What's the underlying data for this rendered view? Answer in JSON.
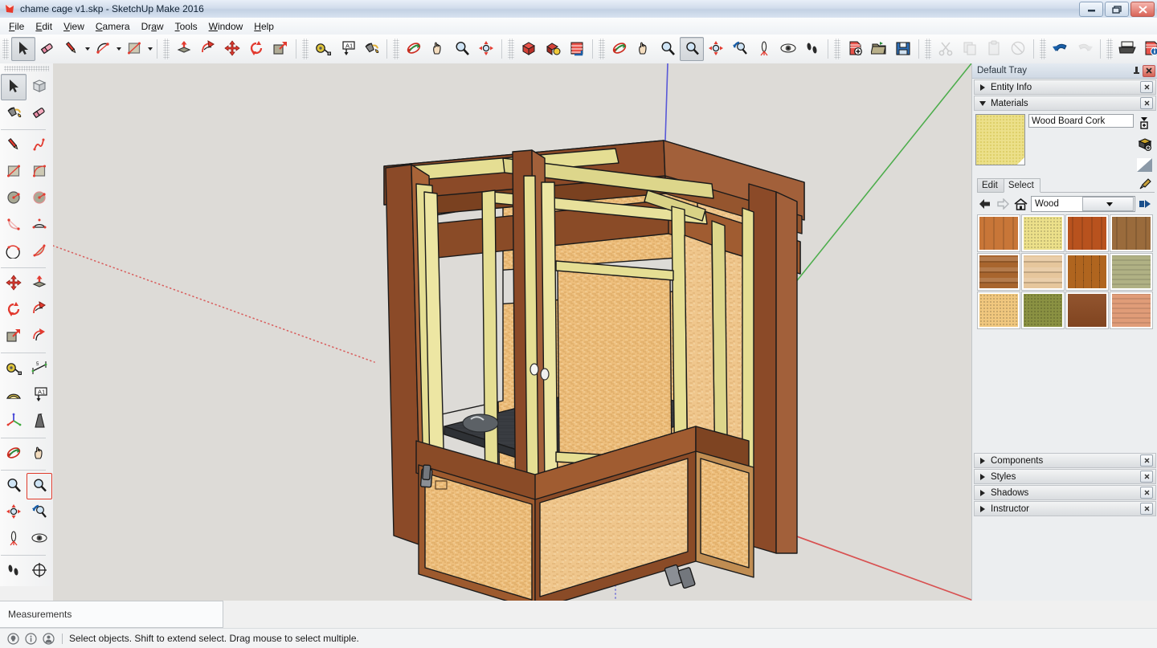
{
  "window": {
    "title": "chame cage v1.skp - SketchUp Make 2016",
    "app_icon": "sketchup-logo-icon",
    "minimize_label": "Minimize",
    "maximize_label": "Restore",
    "close_label": "Close"
  },
  "menu": {
    "items": [
      {
        "label": "File",
        "accel": "F"
      },
      {
        "label": "Edit",
        "accel": "E"
      },
      {
        "label": "View",
        "accel": "V"
      },
      {
        "label": "Camera",
        "accel": "C"
      },
      {
        "label": "Draw",
        "accel": "a"
      },
      {
        "label": "Tools",
        "accel": "T"
      },
      {
        "label": "Window",
        "accel": "W"
      },
      {
        "label": "Help",
        "accel": "H"
      }
    ]
  },
  "top_toolbar": {
    "groups": [
      {
        "name": "drawing-tools",
        "buttons": [
          {
            "name": "select-tool",
            "icon": "arrow-cursor-icon",
            "active": true
          },
          {
            "name": "eraser-tool",
            "icon": "eraser-icon",
            "active": false
          },
          {
            "name": "line-tool",
            "icon": "pencil-icon",
            "active": false,
            "dropdown": true
          },
          {
            "name": "arc-tool",
            "icon": "arc-icon",
            "active": false,
            "dropdown": true
          },
          {
            "name": "rectangle-tool",
            "icon": "rectangle-icon",
            "active": false,
            "dropdown": true
          }
        ]
      },
      {
        "name": "modify-tools",
        "buttons": [
          {
            "name": "pushpull-tool",
            "icon": "pushpull-icon",
            "active": false
          },
          {
            "name": "followme-tool",
            "icon": "followme-icon",
            "active": false
          },
          {
            "name": "move-tool",
            "icon": "move-arrows-icon",
            "active": false
          },
          {
            "name": "rotate-tool",
            "icon": "rotate-icon",
            "active": false
          },
          {
            "name": "scale-tool",
            "icon": "scale-icon",
            "active": false
          }
        ]
      },
      {
        "name": "construction-tools",
        "buttons": [
          {
            "name": "tape-measure-tool",
            "icon": "tape-measure-icon",
            "active": false
          },
          {
            "name": "text-tool",
            "icon": "text-label-icon",
            "active": false
          },
          {
            "name": "paint-bucket-tool",
            "icon": "paint-bucket-icon",
            "active": false
          }
        ]
      },
      {
        "name": "camera-tools-1",
        "buttons": [
          {
            "name": "orbit-tool",
            "icon": "orbit-icon",
            "active": false
          },
          {
            "name": "pan-tool",
            "icon": "hand-pan-icon",
            "active": false
          },
          {
            "name": "zoom-tool",
            "icon": "magnifier-icon",
            "active": false
          },
          {
            "name": "zoom-extents-tool",
            "icon": "zoom-extents-icon",
            "active": false
          }
        ]
      },
      {
        "name": "view-styles",
        "buttons": [
          {
            "name": "style-xray",
            "icon": "xray-box-icon",
            "active": false
          },
          {
            "name": "style-shaded",
            "icon": "shaded-box-icon",
            "active": false
          },
          {
            "name": "style-texture",
            "icon": "texture-box-icon",
            "active": false
          }
        ]
      },
      {
        "name": "camera-tools-2",
        "buttons": [
          {
            "name": "orbit-tool-2",
            "icon": "orbit-icon",
            "active": false
          },
          {
            "name": "pan-tool-2",
            "icon": "hand-pan-icon",
            "active": false
          },
          {
            "name": "zoom-tool-2",
            "icon": "magnifier-icon",
            "active": false
          },
          {
            "name": "zoom-window-tool",
            "icon": "zoom-window-icon",
            "active": true
          },
          {
            "name": "zoom-extents-tool-2",
            "icon": "zoom-extents-icon",
            "active": false
          },
          {
            "name": "previous-view-tool",
            "icon": "previous-view-icon",
            "active": false
          },
          {
            "name": "position-camera-tool",
            "icon": "position-camera-icon",
            "active": false
          },
          {
            "name": "look-around-tool",
            "icon": "eye-icon",
            "active": false
          },
          {
            "name": "walk-tool",
            "icon": "footprints-icon",
            "active": false
          }
        ]
      },
      {
        "name": "file-tools",
        "buttons": [
          {
            "name": "new-file-button",
            "icon": "new-document-icon",
            "active": false
          },
          {
            "name": "open-file-button",
            "icon": "open-folder-icon",
            "active": false
          },
          {
            "name": "save-file-button",
            "icon": "floppy-save-icon",
            "active": false
          }
        ]
      },
      {
        "name": "edit-tools",
        "buttons": [
          {
            "name": "cut-button",
            "icon": "scissors-icon",
            "disabled": true
          },
          {
            "name": "copy-button",
            "icon": "copy-icon",
            "disabled": true
          },
          {
            "name": "paste-button",
            "icon": "paste-clipboard-icon",
            "disabled": true
          },
          {
            "name": "erase-button",
            "icon": "circle-slash-icon",
            "disabled": true
          }
        ]
      },
      {
        "name": "history-tools",
        "buttons": [
          {
            "name": "undo-button",
            "icon": "undo-arrow-icon",
            "disabled": false
          },
          {
            "name": "redo-button",
            "icon": "redo-arrow-icon",
            "disabled": true
          }
        ]
      },
      {
        "name": "output-tools",
        "buttons": [
          {
            "name": "print-button",
            "icon": "printer-icon",
            "active": false
          },
          {
            "name": "model-info-button",
            "icon": "info-logo-icon",
            "active": false
          }
        ]
      }
    ]
  },
  "left_toolbar": {
    "rows": [
      [
        {
          "name": "select-tool",
          "icon": "arrow-cursor-icon",
          "active": true
        },
        {
          "name": "make-component-tool",
          "icon": "component-box-icon",
          "active": false
        }
      ],
      [
        {
          "name": "paint-bucket-tool",
          "icon": "paint-bucket-icon",
          "active": false
        },
        {
          "name": "eraser-tool",
          "icon": "eraser-icon",
          "active": false
        }
      ],
      [
        {
          "name": "line-tool",
          "icon": "pencil-icon",
          "active": false
        },
        {
          "name": "freehand-tool",
          "icon": "freehand-squiggle-icon",
          "active": false
        }
      ],
      [
        {
          "name": "rectangle-tool",
          "icon": "rectangle-icon",
          "active": false
        },
        {
          "name": "rotated-rectangle-tool",
          "icon": "rotated-rectangle-icon",
          "active": false
        }
      ],
      [
        {
          "name": "circle-tool",
          "icon": "circle-icon",
          "active": false
        },
        {
          "name": "polygon-tool",
          "icon": "polygon-icon",
          "active": false
        }
      ],
      [
        {
          "name": "arc-tool",
          "icon": "arc-2point-icon",
          "active": false
        },
        {
          "name": "two-point-arc-tool",
          "icon": "arc-protractor-icon",
          "active": false
        }
      ],
      [
        {
          "name": "three-point-arc-tool",
          "icon": "arc-3point-icon",
          "active": false
        },
        {
          "name": "pie-tool",
          "icon": "pie-icon",
          "active": false
        }
      ],
      [
        {
          "name": "move-tool",
          "icon": "move-arrows-icon",
          "active": false
        },
        {
          "name": "pushpull-tool",
          "icon": "pushpull-icon",
          "active": false
        }
      ],
      [
        {
          "name": "rotate-tool",
          "icon": "rotate-icon",
          "active": false
        },
        {
          "name": "followme-tool",
          "icon": "followme-icon",
          "active": false
        }
      ],
      [
        {
          "name": "scale-tool",
          "icon": "scale-icon",
          "active": false
        },
        {
          "name": "offset-tool",
          "icon": "offset-icon",
          "active": false
        }
      ],
      [
        {
          "name": "tape-measure-tool",
          "icon": "tape-measure-icon",
          "active": false
        },
        {
          "name": "dimension-tool",
          "icon": "dimension-icon",
          "active": false
        }
      ],
      [
        {
          "name": "protractor-tool",
          "icon": "protractor-icon",
          "active": false
        },
        {
          "name": "text-tool",
          "icon": "text-label-icon",
          "active": false
        }
      ],
      [
        {
          "name": "axes-tool",
          "icon": "axes-icon",
          "active": false
        },
        {
          "name": "three-d-text-tool",
          "icon": "3d-text-icon",
          "active": false
        }
      ],
      [
        {
          "name": "orbit-tool",
          "icon": "orbit-icon",
          "active": false
        },
        {
          "name": "pan-tool",
          "icon": "hand-pan-icon",
          "active": false
        }
      ],
      [
        {
          "name": "zoom-tool",
          "icon": "magnifier-icon",
          "active": false
        },
        {
          "name": "zoom-window-tool",
          "icon": "zoom-window-icon",
          "active": true
        }
      ],
      [
        {
          "name": "zoom-extents-tool",
          "icon": "zoom-extents-icon",
          "active": false
        },
        {
          "name": "previous-view-tool",
          "icon": "previous-view-icon",
          "active": false
        }
      ],
      [
        {
          "name": "position-camera-tool",
          "icon": "position-camera-icon",
          "active": false
        },
        {
          "name": "look-around-tool",
          "icon": "eye-icon",
          "active": false
        }
      ],
      [
        {
          "name": "walk-tool",
          "icon": "footprints-icon",
          "active": false
        },
        {
          "name": "section-plane-tool",
          "icon": "section-plane-icon",
          "active": false
        }
      ]
    ]
  },
  "tray": {
    "title": "Default Tray",
    "pin_icon": "pin-icon",
    "close_icon": "close-icon",
    "panels": [
      {
        "name": "entity-info",
        "label": "Entity Info",
        "expanded": false
      },
      {
        "name": "materials",
        "label": "Materials",
        "expanded": true
      },
      {
        "name": "components",
        "label": "Components",
        "expanded": false
      },
      {
        "name": "styles",
        "label": "Styles",
        "expanded": false
      },
      {
        "name": "shadows",
        "label": "Shadows",
        "expanded": false
      },
      {
        "name": "instructor",
        "label": "Instructor",
        "expanded": false
      }
    ]
  },
  "materials": {
    "current_name": "Wood Board Cork",
    "preview_color": "#ece08a",
    "side_buttons": [
      {
        "name": "create-material-button",
        "icon": "create-material-icon"
      },
      {
        "name": "set-default-button",
        "icon": "paint-bucket-3d-icon"
      },
      {
        "name": "display-secondary-button",
        "icon": "triangle-swatch-icon"
      }
    ],
    "tabs": [
      {
        "name": "select-tab",
        "label": "Select",
        "selected": true
      },
      {
        "name": "edit-tab",
        "label": "Edit",
        "selected": false
      }
    ],
    "eyedropper_icon": "eyedropper-icon",
    "nav": {
      "back_icon": "back-arrow-icon",
      "forward_icon": "forward-arrow-icon",
      "home_icon": "home-icon",
      "details_icon": "details-arrow-icon",
      "collection": "Wood"
    },
    "swatches": [
      {
        "name": "wood-cherry-original",
        "color": "#c87638",
        "pattern": "vertical-grain"
      },
      {
        "name": "wood-board-cork",
        "color": "#ece08a",
        "pattern": "speckle"
      },
      {
        "name": "wood-cherry",
        "color": "#b8521e",
        "pattern": "vertical-grain"
      },
      {
        "name": "wood-floor-dark",
        "color": "#9a6b3c",
        "pattern": "vertical-grain"
      },
      {
        "name": "wood-floor-light",
        "color": "#a8652e",
        "pattern": "horizontal-plank"
      },
      {
        "name": "wood-bamboo",
        "color": "#e6c69c",
        "pattern": "horizontal-plank"
      },
      {
        "name": "wood-parquet",
        "color": "#b0651f",
        "pattern": "parquet"
      },
      {
        "name": "wood-ash",
        "color": "#b0b184",
        "pattern": "horizontal-grain"
      },
      {
        "name": "wood-osb",
        "color": "#f0c77e",
        "pattern": "speckle"
      },
      {
        "name": "wood-olive",
        "color": "#8a9142",
        "pattern": "speckle"
      },
      {
        "name": "wood-mahogany",
        "color": "#8b4a22",
        "pattern": "plain"
      },
      {
        "name": "wood-birch",
        "color": "#e09c78",
        "pattern": "horizontal-grain"
      }
    ]
  },
  "viewport": {
    "background_color": "#dddbd7",
    "model_name": "chameleon-cage-3d-model",
    "axes": [
      {
        "name": "red-axis",
        "color": "#d84a4a"
      },
      {
        "name": "green-axis",
        "color": "#3fa93f"
      },
      {
        "name": "blue-axis",
        "color": "#4a4ad8"
      }
    ],
    "materials_used": {
      "frame_dark": "#8B4A28",
      "frame_mid": "#A35D2E",
      "trim_pale": "#E5DE93",
      "osb_panel": "#EDBE7C",
      "floor_dark": "#3a3d42",
      "hinge_grey": "#8b8f95"
    }
  },
  "measurements": {
    "label": "Measurements",
    "value": ""
  },
  "statusbar": {
    "icons": [
      {
        "name": "lightbulb-icon"
      },
      {
        "name": "info-circle-icon"
      },
      {
        "name": "person-circle-icon"
      }
    ],
    "message": "Select objects. Shift to extend select. Drag mouse to select multiple."
  }
}
